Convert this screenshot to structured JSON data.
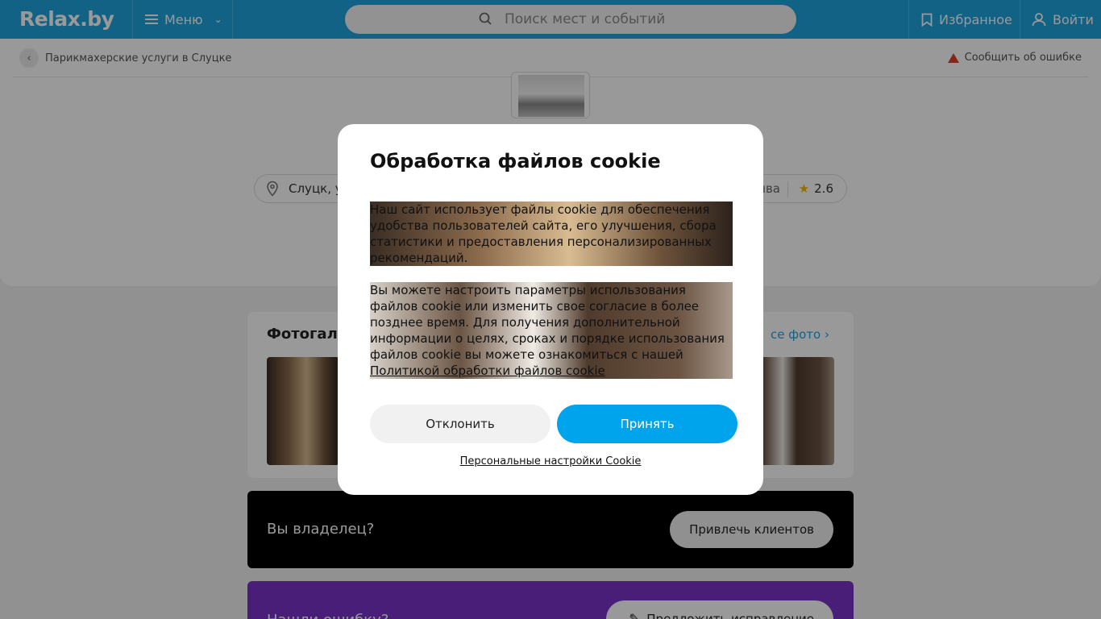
{
  "topbar": {
    "logo": "Relax.by",
    "menu_label": "Меню",
    "search_placeholder": "Поиск мест и событий",
    "favorites_label": "Избранное",
    "login_label": "Войти"
  },
  "header": {
    "breadcrumb": "Парикмахерские услуги в Слуцке",
    "report": "Сообщить об ошибке",
    "location": "Слуцк, у",
    "reviews": "ыва",
    "rating": "2.6"
  },
  "gallery": {
    "title": "Фотогале",
    "all_photos": "се фото"
  },
  "owner": {
    "title": "Вы владелец?",
    "button": "Привлечь клиентов"
  },
  "error_card": {
    "title": "Нашли ошибку?",
    "button": "Предложить исправление"
  },
  "cookie": {
    "title": "Обработка файлов cookie",
    "paragraph1": "Наш сайт использует файлы cookie для обеспечения удобства пользователей сайта, его улучшения, сбора статистики и предоставления персонализированных рекомендаций.",
    "paragraph2": "Вы можете настроить параметры использования файлов cookie или изменить свое согласие в более позднее время. Для получения дополнительной информации о целях, сроках и порядке использования файлов cookie вы можете ознакомиться с нашей",
    "policy_link": "Политикой обработки файлов cookie",
    "decline": "Отклонить",
    "accept": "Принять",
    "personal_settings": "Персональные настройки Cookie"
  }
}
